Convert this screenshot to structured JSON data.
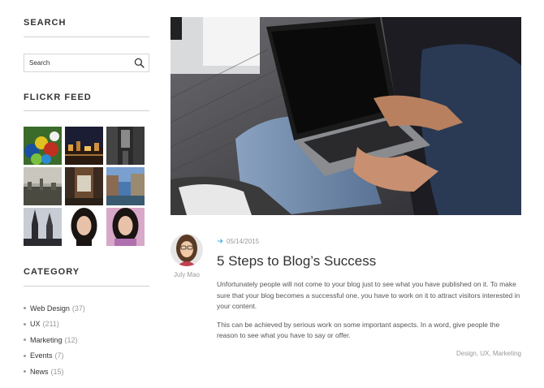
{
  "sidebar": {
    "search": {
      "title": "SEARCH",
      "placeholder": "Search",
      "icon": "search-icon"
    },
    "flickr": {
      "title": "FLICKR FEED",
      "photos": [
        "colorful-figurines",
        "city-night",
        "dark-alley",
        "city-skyline",
        "street-view",
        "canal-town",
        "gothic-spires",
        "portrait-woman",
        "portrait-woman-purple"
      ]
    },
    "category": {
      "title": "CATEGORY",
      "items": [
        {
          "label": "Web Design",
          "count": "(37)"
        },
        {
          "label": "UX",
          "count": "(211)"
        },
        {
          "label": "Marketing",
          "count": "(12)"
        },
        {
          "label": "Events",
          "count": "(7)"
        },
        {
          "label": "News",
          "count": "(15)"
        }
      ]
    }
  },
  "post": {
    "author": "July Mao",
    "date": "05/14/2015",
    "title": "5 Steps to Blog’s Success",
    "paragraphs": [
      "Unfortunately people will not come to your blog just to see what you have published on it. To make sure that your blog becomes a successful one, you have to work on it to attract visitors interested in your content.",
      "This can be achieved by serious work on some important aspects. In a word, give people the reason to see what you have to say or offer."
    ],
    "tags": "Design, UX, Marketing"
  },
  "colors": {
    "accent": "#3aa8d8",
    "text": "#333333",
    "muted": "#999999"
  }
}
